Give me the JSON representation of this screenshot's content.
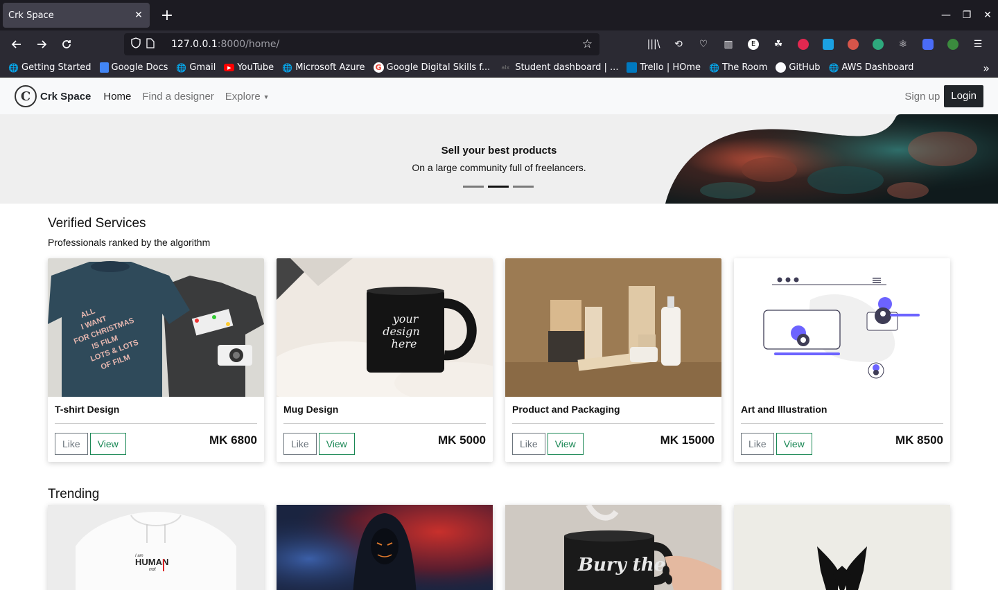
{
  "browser": {
    "tab_title": "Crk Space",
    "tab_close": "✕",
    "new_tab": "+",
    "url_host": "127.0.0.1",
    "url_path": ":8000/home/",
    "window_controls": [
      "—",
      "❐",
      "✕"
    ],
    "bookmarks": [
      {
        "label": "Getting Started",
        "icon": "globe-icon"
      },
      {
        "label": "Google Docs",
        "icon": "docs-icon"
      },
      {
        "label": "Gmail",
        "icon": "globe-icon"
      },
      {
        "label": "YouTube",
        "icon": "youtube-icon"
      },
      {
        "label": "Microsoft Azure",
        "icon": "globe-icon"
      },
      {
        "label": "Google Digital Skills f...",
        "icon": "google-icon"
      },
      {
        "label": "Student dashboard | ...",
        "icon": "alx-icon"
      },
      {
        "label": "Trello | HOme",
        "icon": "trello-icon"
      },
      {
        "label": "The Room",
        "icon": "globe-icon"
      },
      {
        "label": "GitHub",
        "icon": "github-icon"
      },
      {
        "label": "AWS Dashboard",
        "icon": "globe-icon"
      }
    ]
  },
  "site": {
    "brand": "Crk Space",
    "brand_logo": "C",
    "nav": {
      "home": "Home",
      "find": "Find a designer",
      "explore": "Explore"
    },
    "signup": "Sign up",
    "login": "Login"
  },
  "hero": {
    "title": "Sell your best products",
    "subtitle": "On a large community full of freelancers.",
    "slides": 3,
    "active_slide": 2
  },
  "verified": {
    "title": "Verified Services",
    "subtitle": "Professionals ranked by the algorithm",
    "cards": [
      {
        "title": "T-shirt Design",
        "price": "MK 6800",
        "like": "Like",
        "view": "View"
      },
      {
        "title": "Mug Design",
        "price": "MK 5000",
        "like": "Like",
        "view": "View"
      },
      {
        "title": "Product and Packaging",
        "price": "MK 15000",
        "like": "Like",
        "view": "View"
      },
      {
        "title": "Art and Illustration",
        "price": "MK 8500",
        "like": "Like",
        "view": "View"
      }
    ]
  },
  "trending": {
    "title": "Trending"
  },
  "image_text": {
    "tshirt": [
      "ALL",
      "I WANT",
      "FOR CHRISTMAS",
      "IS FILM",
      "LOTS & LOTS",
      "OF FILM"
    ],
    "mug": [
      "your",
      "design",
      "here"
    ],
    "hoodie": [
      "I am",
      "HUMAN",
      "not"
    ],
    "coffee_mug": "Bury the"
  },
  "colors": {
    "chrome_dark": "#1c1b22",
    "chrome_mid": "#2b2a33",
    "view_green": "#198754",
    "like_gray": "#6c757d",
    "login_dark": "#212529"
  }
}
